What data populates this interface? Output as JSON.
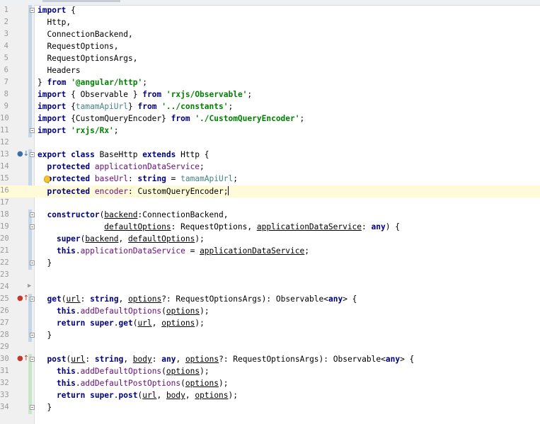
{
  "lines": [
    {
      "n": "1",
      "parts": [
        [
          "kw",
          "import"
        ],
        [
          "p",
          " {"
        ]
      ],
      "fold": "box"
    },
    {
      "n": "2",
      "parts": [
        [
          "p",
          "  Http,"
        ]
      ]
    },
    {
      "n": "3",
      "parts": [
        [
          "p",
          "  ConnectionBackend,"
        ]
      ]
    },
    {
      "n": "4",
      "parts": [
        [
          "p",
          "  RequestOptions,"
        ]
      ]
    },
    {
      "n": "5",
      "parts": [
        [
          "p",
          "  RequestOptionsArgs,"
        ]
      ]
    },
    {
      "n": "6",
      "parts": [
        [
          "p",
          "  Headers"
        ]
      ]
    },
    {
      "n": "7",
      "parts": [
        [
          "p",
          "} "
        ],
        [
          "kw",
          "from"
        ],
        [
          "p",
          " "
        ],
        [
          "str",
          "'@angular/http'"
        ],
        [
          "p",
          ";"
        ]
      ]
    },
    {
      "n": "8",
      "parts": [
        [
          "kw",
          "import"
        ],
        [
          "p",
          " { Observable } "
        ],
        [
          "kw",
          "from"
        ],
        [
          "p",
          " "
        ],
        [
          "str",
          "'rxjs/Observable'"
        ],
        [
          "p",
          ";"
        ]
      ]
    },
    {
      "n": "9",
      "parts": [
        [
          "kw",
          "import"
        ],
        [
          "p",
          " {"
        ],
        [
          "imp",
          "tamamApiUrl"
        ],
        [
          "p",
          "} "
        ],
        [
          "kw",
          "from"
        ],
        [
          "p",
          " "
        ],
        [
          "str",
          "'../constants'"
        ],
        [
          "p",
          ";"
        ]
      ]
    },
    {
      "n": "10",
      "parts": [
        [
          "kw",
          "import"
        ],
        [
          "p",
          " {CustomQueryEncoder} "
        ],
        [
          "kw",
          "from"
        ],
        [
          "p",
          " "
        ],
        [
          "str",
          "'./CustomQueryEncoder'"
        ],
        [
          "p",
          ";"
        ]
      ]
    },
    {
      "n": "11",
      "parts": [
        [
          "kw",
          "import"
        ],
        [
          "p",
          " "
        ],
        [
          "str",
          "'rxjs/Rx'"
        ],
        [
          "p",
          ";"
        ]
      ],
      "fold": "box"
    },
    {
      "n": "12",
      "parts": []
    },
    {
      "n": "13",
      "parts": [
        [
          "kw",
          "export class"
        ],
        [
          "p",
          " BaseHttp "
        ],
        [
          "kw",
          "extends"
        ],
        [
          "p",
          " Http {"
        ]
      ],
      "fold": "box",
      "icon": "down"
    },
    {
      "n": "14",
      "parts": [
        [
          "p",
          "  "
        ],
        [
          "kw",
          "protected"
        ],
        [
          "p",
          " "
        ],
        [
          "fld",
          "applicationDataService"
        ],
        [
          "p",
          ";"
        ]
      ]
    },
    {
      "n": "15",
      "parts": [
        [
          "p",
          "  "
        ],
        [
          "kw",
          "protected"
        ],
        [
          "p",
          " "
        ],
        [
          "fld",
          "baseUrl"
        ],
        [
          "p",
          ": "
        ],
        [
          "kw",
          "string"
        ],
        [
          "p",
          " = "
        ],
        [
          "imp",
          "tamamApiUrl"
        ],
        [
          "p",
          ";"
        ]
      ],
      "bulb": true
    },
    {
      "n": "16",
      "parts": [
        [
          "p",
          "  "
        ],
        [
          "kw",
          "protected"
        ],
        [
          "p",
          " "
        ],
        [
          "fld",
          "encoder"
        ],
        [
          "p",
          ": CustomQueryEncoder;"
        ]
      ],
      "current": true,
      "caret": true
    },
    {
      "n": "17",
      "parts": []
    },
    {
      "n": "18",
      "parts": [
        [
          "p",
          "  "
        ],
        [
          "kw",
          "constructor"
        ],
        [
          "p",
          "("
        ],
        [
          "ul",
          "backend"
        ],
        [
          "p",
          ":ConnectionBackend,"
        ]
      ],
      "fold": "box"
    },
    {
      "n": "19",
      "parts": [
        [
          "p",
          "              "
        ],
        [
          "ul",
          "defaultOptions"
        ],
        [
          "p",
          ": RequestOptions, "
        ],
        [
          "ul",
          "applicationDataService"
        ],
        [
          "p",
          ": "
        ],
        [
          "kw",
          "any"
        ],
        [
          "p",
          ") {"
        ]
      ],
      "fold": "box"
    },
    {
      "n": "20",
      "parts": [
        [
          "p",
          "    "
        ],
        [
          "kw",
          "super"
        ],
        [
          "p",
          "("
        ],
        [
          "ul",
          "backend"
        ],
        [
          "p",
          ", "
        ],
        [
          "ul",
          "defaultOptions"
        ],
        [
          "p",
          ");"
        ]
      ]
    },
    {
      "n": "21",
      "parts": [
        [
          "p",
          "    "
        ],
        [
          "kw",
          "this"
        ],
        [
          "p",
          "."
        ],
        [
          "fld",
          "applicationDataService"
        ],
        [
          "p",
          " = "
        ],
        [
          "ul",
          "applicationDataService"
        ],
        [
          "p",
          ";"
        ]
      ]
    },
    {
      "n": "22",
      "parts": [
        [
          "p",
          "  }"
        ]
      ],
      "fold": "box"
    },
    {
      "n": "23",
      "parts": []
    },
    {
      "n": "24",
      "parts": [],
      "fold": "arrow"
    },
    {
      "n": "25",
      "parts": [
        [
          "p",
          "  "
        ],
        [
          "kw",
          "get"
        ],
        [
          "p",
          "("
        ],
        [
          "ul",
          "url"
        ],
        [
          "p",
          ": "
        ],
        [
          "kw",
          "string"
        ],
        [
          "p",
          ", "
        ],
        [
          "ul",
          "options"
        ],
        [
          "p",
          "?: RequestOptionsArgs): Observable<"
        ],
        [
          "kw",
          "any"
        ],
        [
          "p",
          "> {"
        ]
      ],
      "fold": "box",
      "icon": "up"
    },
    {
      "n": "26",
      "parts": [
        [
          "p",
          "    "
        ],
        [
          "kw",
          "this"
        ],
        [
          "p",
          "."
        ],
        [
          "fld",
          "addDefaultOptions"
        ],
        [
          "p",
          "("
        ],
        [
          "ul",
          "options"
        ],
        [
          "p",
          ");"
        ]
      ]
    },
    {
      "n": "27",
      "parts": [
        [
          "p",
          "    "
        ],
        [
          "kw",
          "return super"
        ],
        [
          "p",
          "."
        ],
        [
          "kw",
          "get"
        ],
        [
          "p",
          "("
        ],
        [
          "ul",
          "url"
        ],
        [
          "p",
          ", "
        ],
        [
          "ul",
          "options"
        ],
        [
          "p",
          ");"
        ]
      ]
    },
    {
      "n": "28",
      "parts": [
        [
          "p",
          "  }"
        ]
      ],
      "fold": "box"
    },
    {
      "n": "29",
      "parts": []
    },
    {
      "n": "30",
      "parts": [
        [
          "p",
          "  "
        ],
        [
          "kw",
          "post"
        ],
        [
          "p",
          "("
        ],
        [
          "ul",
          "url"
        ],
        [
          "p",
          ": "
        ],
        [
          "kw",
          "string"
        ],
        [
          "p",
          ", "
        ],
        [
          "ul",
          "body"
        ],
        [
          "p",
          ": "
        ],
        [
          "kw",
          "any"
        ],
        [
          "p",
          ", "
        ],
        [
          "ul",
          "options"
        ],
        [
          "p",
          "?: RequestOptionsArgs): Observable<"
        ],
        [
          "kw",
          "any"
        ],
        [
          "p",
          "> {"
        ]
      ],
      "fold": "box",
      "icon": "up"
    },
    {
      "n": "31",
      "parts": [
        [
          "p",
          "    "
        ],
        [
          "kw",
          "this"
        ],
        [
          "p",
          "."
        ],
        [
          "fld",
          "addDefaultOptions"
        ],
        [
          "p",
          "("
        ],
        [
          "ul",
          "options"
        ],
        [
          "p",
          ");"
        ]
      ]
    },
    {
      "n": "32",
      "parts": [
        [
          "p",
          "    "
        ],
        [
          "kw",
          "this"
        ],
        [
          "p",
          "."
        ],
        [
          "fld",
          "addDefaultPostOptions"
        ],
        [
          "p",
          "("
        ],
        [
          "ul",
          "options"
        ],
        [
          "p",
          ");"
        ]
      ]
    },
    {
      "n": "33",
      "parts": [
        [
          "p",
          "    "
        ],
        [
          "kw",
          "return super"
        ],
        [
          "p",
          "."
        ],
        [
          "kw",
          "post"
        ],
        [
          "p",
          "("
        ],
        [
          "ul",
          "url"
        ],
        [
          "p",
          ", "
        ],
        [
          "ul",
          "body"
        ],
        [
          "p",
          ", "
        ],
        [
          "ul",
          "options"
        ],
        [
          "p",
          ");"
        ]
      ]
    },
    {
      "n": "34",
      "parts": [
        [
          "p",
          "  }"
        ]
      ],
      "fold": "box"
    }
  ],
  "change_markers": [
    {
      "from": "1",
      "to": "11",
      "kind": "modified"
    },
    {
      "from": "13",
      "to": "16",
      "kind": "modified"
    },
    {
      "from": "18",
      "to": "22",
      "kind": "modified"
    },
    {
      "from": "25",
      "to": "28",
      "kind": "modified"
    },
    {
      "from": "30",
      "to": "34",
      "kind": "added"
    }
  ],
  "colors": {
    "keyword": "#000080",
    "string": "#008000",
    "field": "#660e7a",
    "imported_constant": "#458383",
    "current_line": "#fffbd9",
    "gutter": "#f0f0f0",
    "line_number": "#999999"
  },
  "icons": {
    "down": "implemented-arrow-icon",
    "up": "override-arrow-icon",
    "bulb": "lightbulb-icon",
    "fold_box": "fold-toggle-icon",
    "fold_arrow": "fold-arrow-icon"
  }
}
